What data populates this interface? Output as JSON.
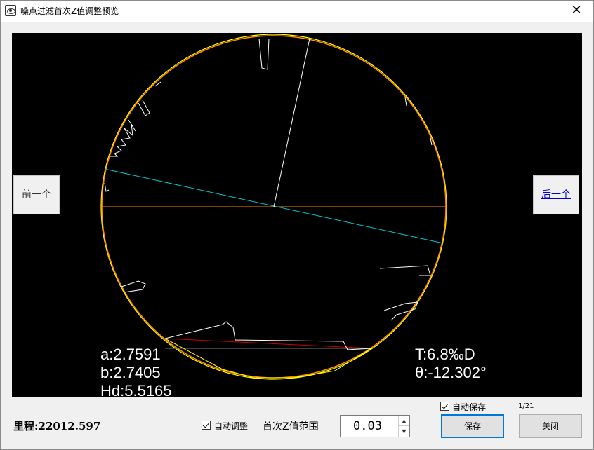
{
  "window": {
    "title": "噪点过滤首次Z值调整预览",
    "close_glyph": "✕"
  },
  "nav": {
    "prev_label": "前一个",
    "next_label": "后一个"
  },
  "overlay": {
    "a": "a:2.7591",
    "b": "b:2.7405",
    "hd": "Hd:5.5165",
    "t": "T:6.8‰D",
    "theta": "θ:-12.302°"
  },
  "footer": {
    "mileage": "里程:22012.597",
    "auto_adjust_label": "自动调整",
    "auto_adjust_checked": true,
    "range_label": "首次Z值范围",
    "range_value": "0.03",
    "auto_save_label": "自动保存",
    "auto_save_checked": true,
    "page_counter": "1/21",
    "save_label": "保存",
    "close_label": "关闭"
  },
  "colors": {
    "canvas_bg": "#000000",
    "fit_ellipse": "#ff8c00",
    "design_circle": "#ffff00",
    "axis_line": "#ff7f00",
    "tilt_line": "#00c8d2",
    "radius_line": "#ffffff",
    "base_line": "#cc0000"
  }
}
